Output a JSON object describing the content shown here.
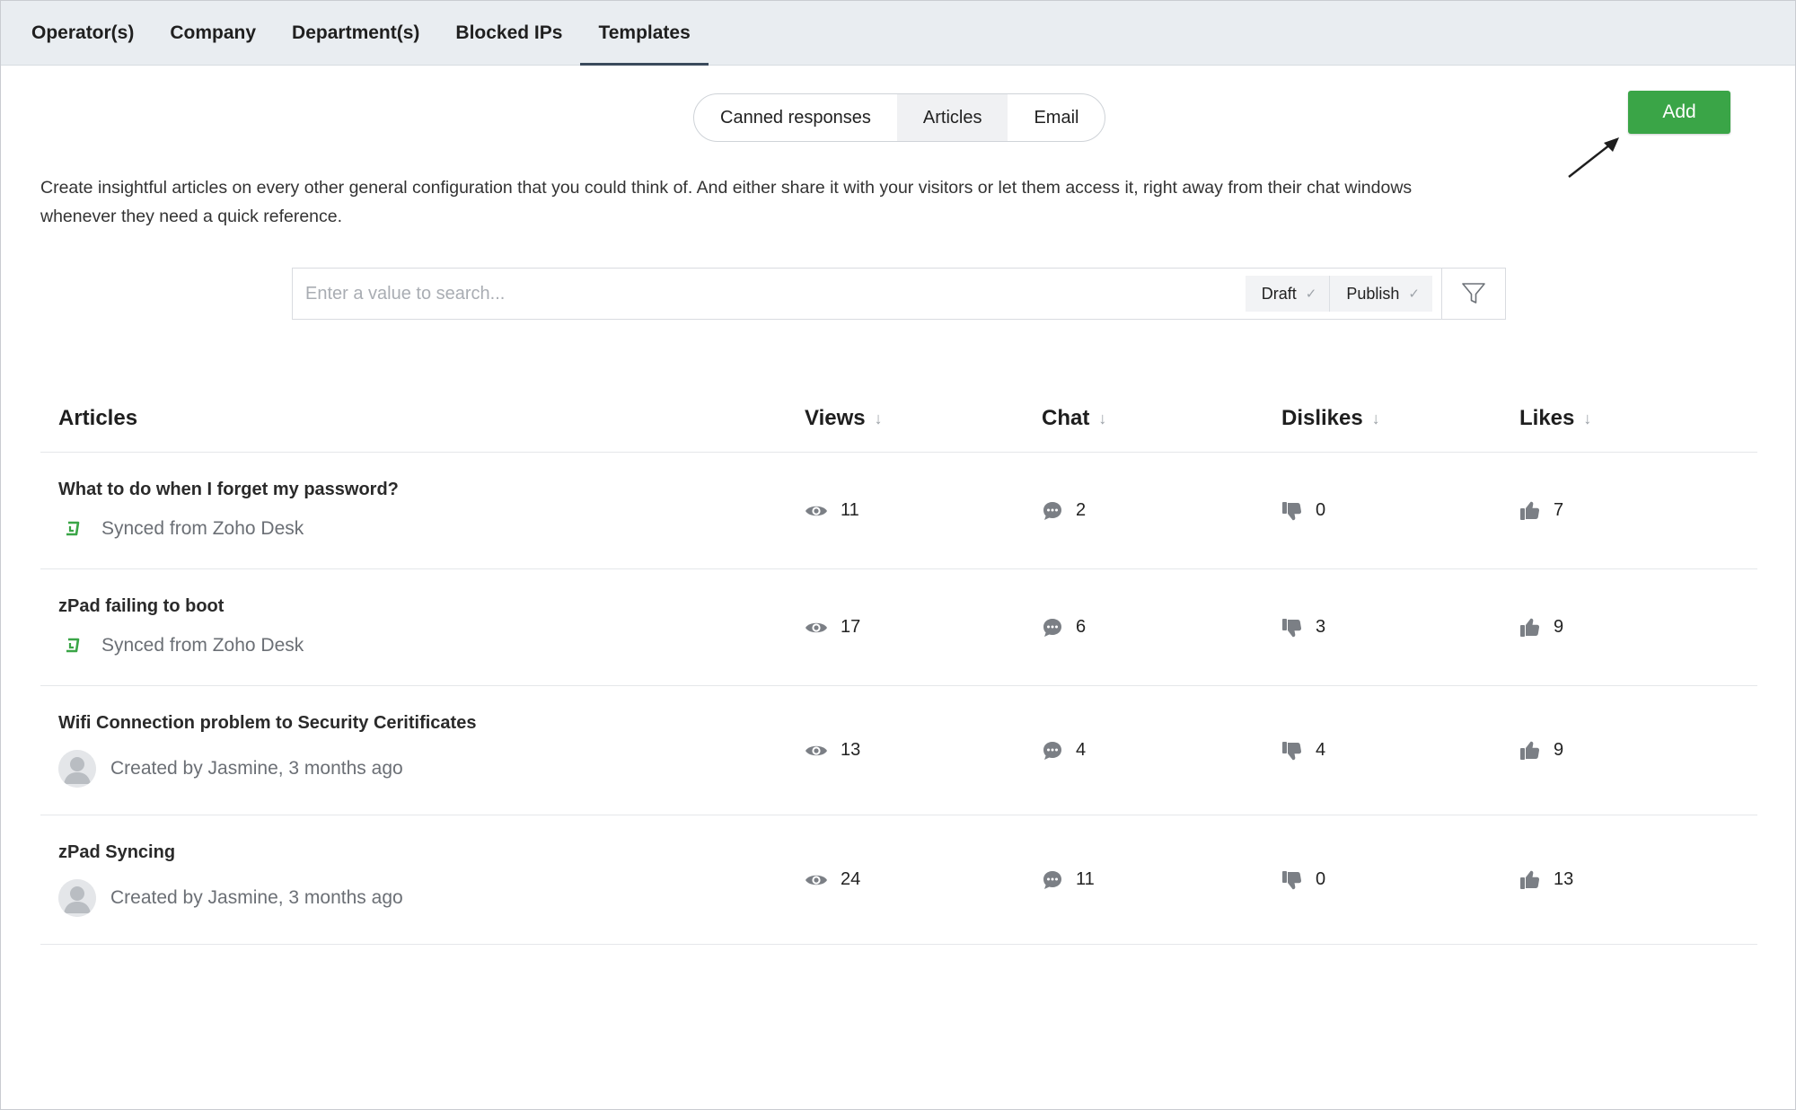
{
  "topnav": {
    "tabs": [
      {
        "label": "Operator(s)"
      },
      {
        "label": "Company"
      },
      {
        "label": "Department(s)"
      },
      {
        "label": "Blocked IPs"
      },
      {
        "label": "Templates"
      }
    ],
    "active_index": 4
  },
  "segments": {
    "items": [
      {
        "label": "Canned responses"
      },
      {
        "label": "Articles"
      },
      {
        "label": "Email"
      }
    ],
    "active_index": 1
  },
  "toolbar": {
    "add_label": "Add"
  },
  "description": "Create insightful articles on every other general configuration that you could think of. And either share it with your visitors or let them access it, right away from their chat windows whenever they need a quick reference.",
  "search": {
    "placeholder": "Enter a value to search...",
    "value": "",
    "filters": [
      {
        "label": "Draft",
        "check": "✓"
      },
      {
        "label": "Publish",
        "check": "✓"
      }
    ]
  },
  "table": {
    "headers": {
      "articles": "Articles",
      "views": "Views",
      "chat": "Chat",
      "dislikes": "Dislikes",
      "likes": "Likes",
      "sort_glyph": "↓"
    },
    "rows": [
      {
        "title": "What to do when I forget my password?",
        "meta": "Synced from Zoho Desk",
        "source": "sync",
        "views": "11",
        "chat": "2",
        "dislikes": "0",
        "likes": "7"
      },
      {
        "title": "zPad failing to boot",
        "meta": "Synced from Zoho Desk",
        "source": "sync",
        "views": "17",
        "chat": "6",
        "dislikes": "3",
        "likes": "9"
      },
      {
        "title": "Wifi Connection problem to Security Ceritificates",
        "meta": "Created by Jasmine, 3 months ago",
        "source": "user",
        "views": "13",
        "chat": "4",
        "dislikes": "4",
        "likes": "9"
      },
      {
        "title": "zPad Syncing",
        "meta": "Created by Jasmine, 3 months ago",
        "source": "user",
        "views": "24",
        "chat": "11",
        "dislikes": "0",
        "likes": "13"
      }
    ]
  },
  "colors": {
    "accent_green": "#3aa547",
    "sync_icon_green": "#3aa547",
    "nav_bg": "#e9edf1",
    "icon_gray": "#7b7f85"
  }
}
